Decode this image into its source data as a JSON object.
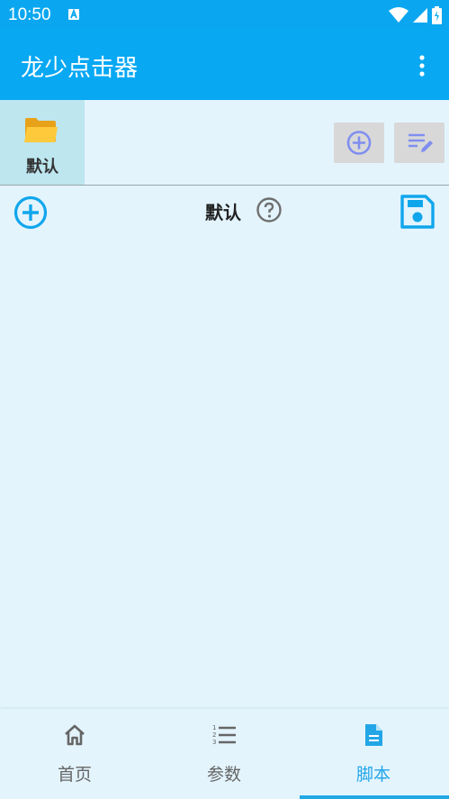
{
  "status": {
    "time": "10:50"
  },
  "app": {
    "title": "龙少点击器"
  },
  "folders": [
    {
      "label": "默认"
    }
  ],
  "script": {
    "title": "默认"
  },
  "nav": [
    {
      "label": "首页"
    },
    {
      "label": "参数"
    },
    {
      "label": "脚本"
    }
  ],
  "colors": {
    "primary": "#08a8f3",
    "background": "#e3f4fd",
    "accent": "#22a6e7",
    "folder_tab": "#bde6ef"
  }
}
